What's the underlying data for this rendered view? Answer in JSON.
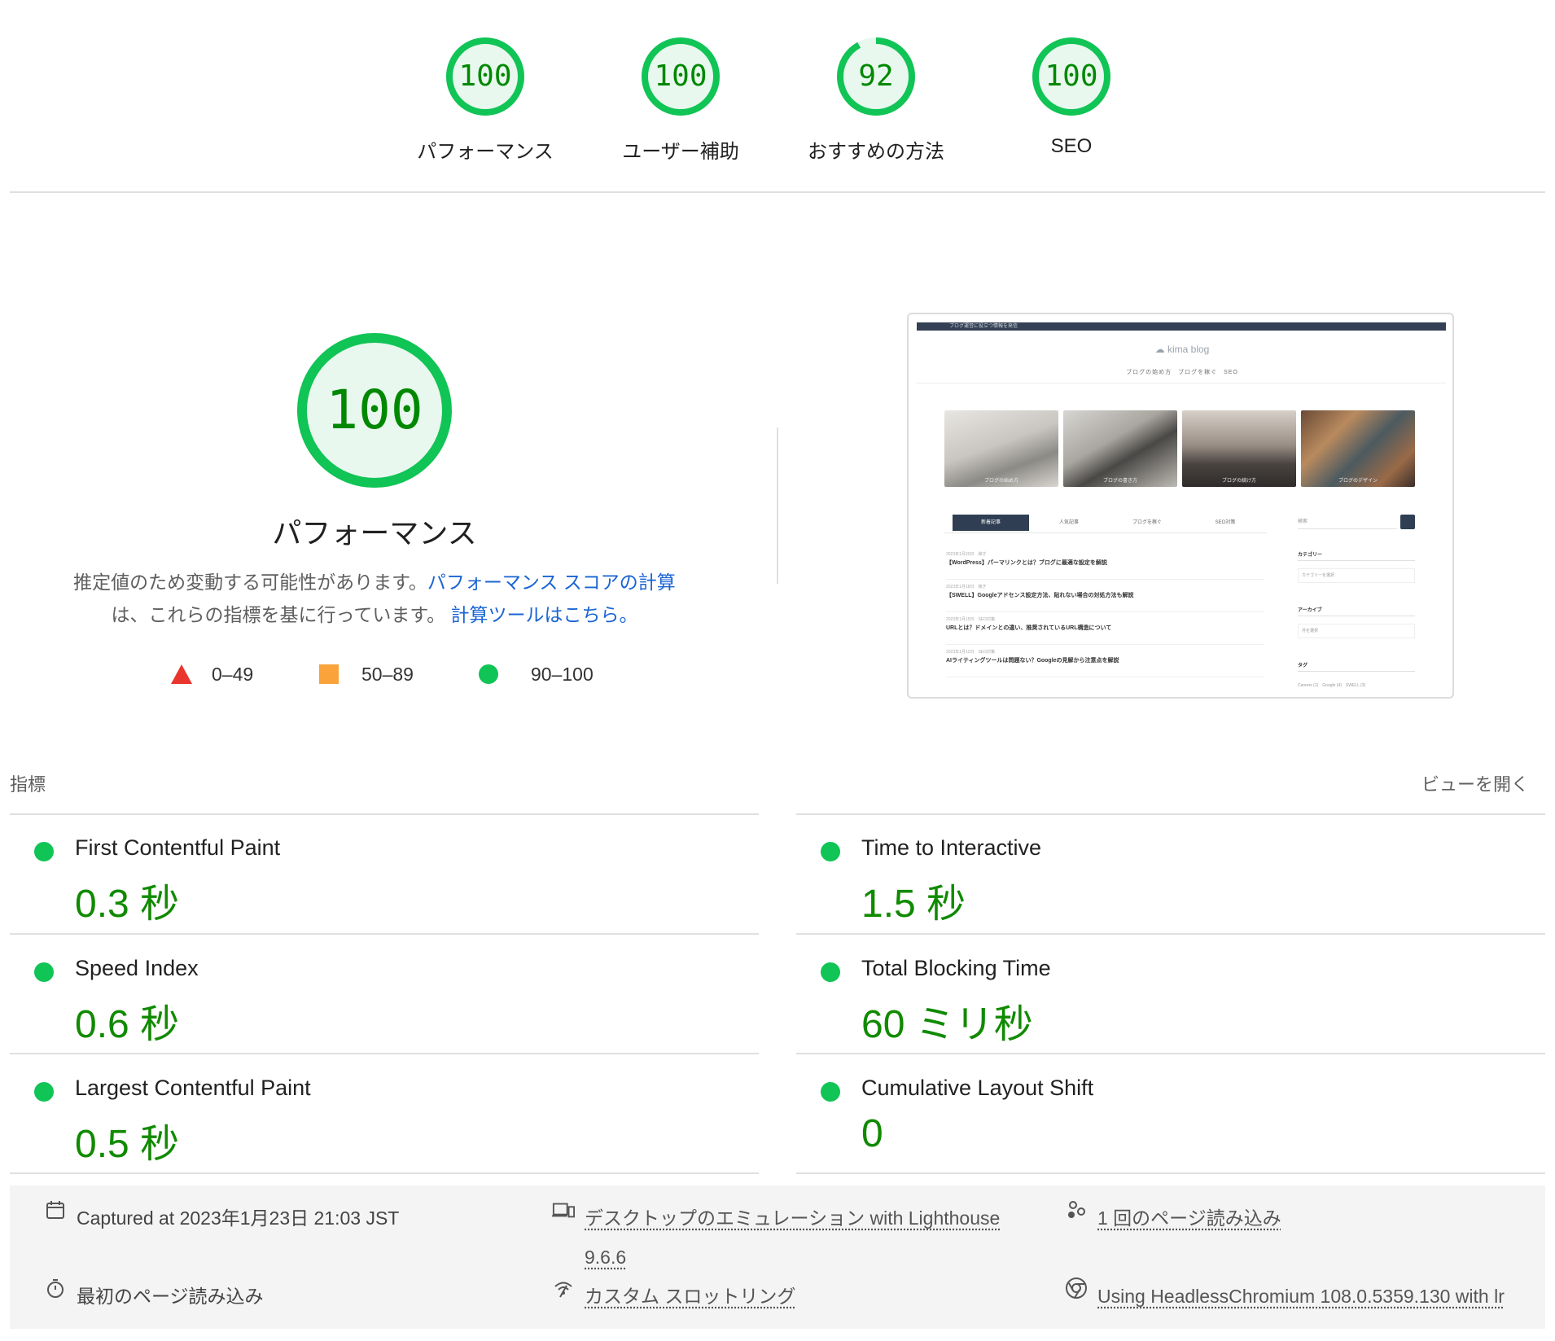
{
  "categories": [
    {
      "score": "100",
      "label": "パフォーマンス",
      "fraction": 1.0
    },
    {
      "score": "100",
      "label": "ユーザー補助",
      "fraction": 1.0
    },
    {
      "score": "92",
      "label": "おすすめの方法",
      "fraction": 0.92
    },
    {
      "score": "100",
      "label": "SEO",
      "fraction": 1.0
    }
  ],
  "performance": {
    "score": "100",
    "title": "パフォーマンス",
    "desc_text1": "推定値のため変動する可能性があります。",
    "desc_link1": "パフォーマンス スコアの計算",
    "desc_text2": "は、これらの指標を基に行っています。",
    "desc_link2": "計算ツールはこちら。"
  },
  "legend": [
    {
      "shape": "triangle",
      "range": "0–49",
      "color": "#e8362f"
    },
    {
      "shape": "square",
      "range": "50–89",
      "color": "#f9a33a"
    },
    {
      "shape": "circle",
      "range": "90–100",
      "color": "#10c455"
    }
  ],
  "thumbnail": {
    "topbar_text": "ブログ運営に役立つ情報を発信",
    "logo": "kima blog",
    "nav": "ブログの始め方　ブログを稼ぐ　SEO",
    "pics": [
      "ブログの始め方",
      "ブログの書き方",
      "ブログの続け方",
      "ブログのデザイン"
    ],
    "tabs": [
      "新着記事",
      "人気記事",
      "ブログを稼ぐ",
      "SEO対策"
    ],
    "search_placeholder": "検索",
    "posts": [
      {
        "meta": "2023年1月20日　稼ぎ",
        "title": "【WordPress】パーマリンクとは？ブログに最適な設定を解説"
      },
      {
        "meta": "2023年1月18日　稼ぎ",
        "title": "【SWELL】Googleアドセンス設定方法、貼れない場合の対処方法も解説"
      },
      {
        "meta": "2023年1月15日　SEO対策",
        "title": "URLとは？ドメインとの違い、推奨されているURL構造について"
      },
      {
        "meta": "2023年1月12日　SEO対策",
        "title": "AIライティングツールは問題ない？Googleの見解から注意点を解説"
      }
    ],
    "side_titles": [
      "カテゴリー",
      "アーカイブ",
      "タグ"
    ],
    "side_selects": [
      "カテゴリーを選択",
      "月を選択"
    ],
    "tags": "Careers (1)　Google (4)　SWELL (3)"
  },
  "metrics_header": {
    "title": "指標",
    "toggle": "ビューを開く"
  },
  "metrics": [
    {
      "name": "First Contentful Paint",
      "value": "0.3 秒"
    },
    {
      "name": "Time to Interactive",
      "value": "1.5 秒"
    },
    {
      "name": "Speed Index",
      "value": "0.6 秒"
    },
    {
      "name": "Total Blocking Time",
      "value": "60 ミリ秒"
    },
    {
      "name": "Largest Contentful Paint",
      "value": "0.5 秒"
    },
    {
      "name": "Cumulative Layout Shift",
      "value": "0"
    }
  ],
  "footer": {
    "captured": "Captured at 2023年1月23日 21:03 JST",
    "emulation_line1": "デスクトップのエミュレーション with Lighthouse",
    "emulation_line2": "9.6.6",
    "page_loads": "1 回のページ読み込み",
    "initial_load": "最初のページ読み込み",
    "throttling": "カスタム スロットリング",
    "browser": "Using HeadlessChromium 108.0.5359.130 with lr"
  }
}
